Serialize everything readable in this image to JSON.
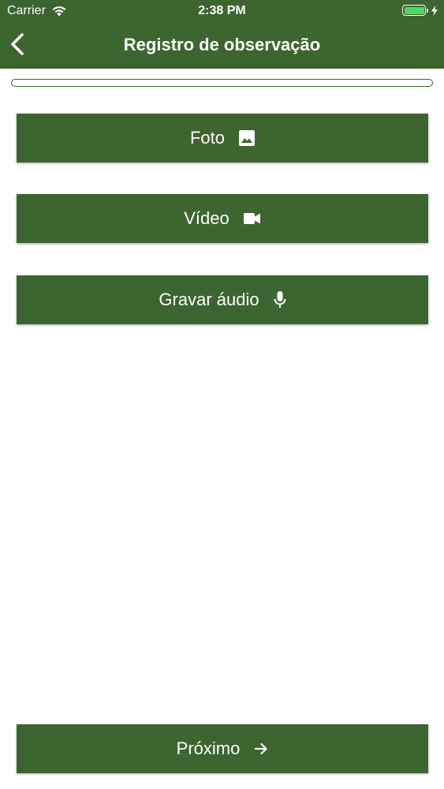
{
  "status_bar": {
    "carrier": "Carrier",
    "time": "2:38 PM",
    "battery_color": "#4cd964"
  },
  "header": {
    "title": "Registro de observação",
    "back_icon": "chevron-left-icon",
    "background": "#3d6530"
  },
  "progress": {
    "value": 0
  },
  "actions": {
    "foto": {
      "label": "Foto",
      "icon": "image-icon"
    },
    "video": {
      "label": "Vídeo",
      "icon": "videocam-icon"
    },
    "audio": {
      "label": "Gravar áudio",
      "icon": "mic-icon"
    }
  },
  "footer": {
    "next_label": "Próximo",
    "next_icon": "arrow-right-icon"
  }
}
